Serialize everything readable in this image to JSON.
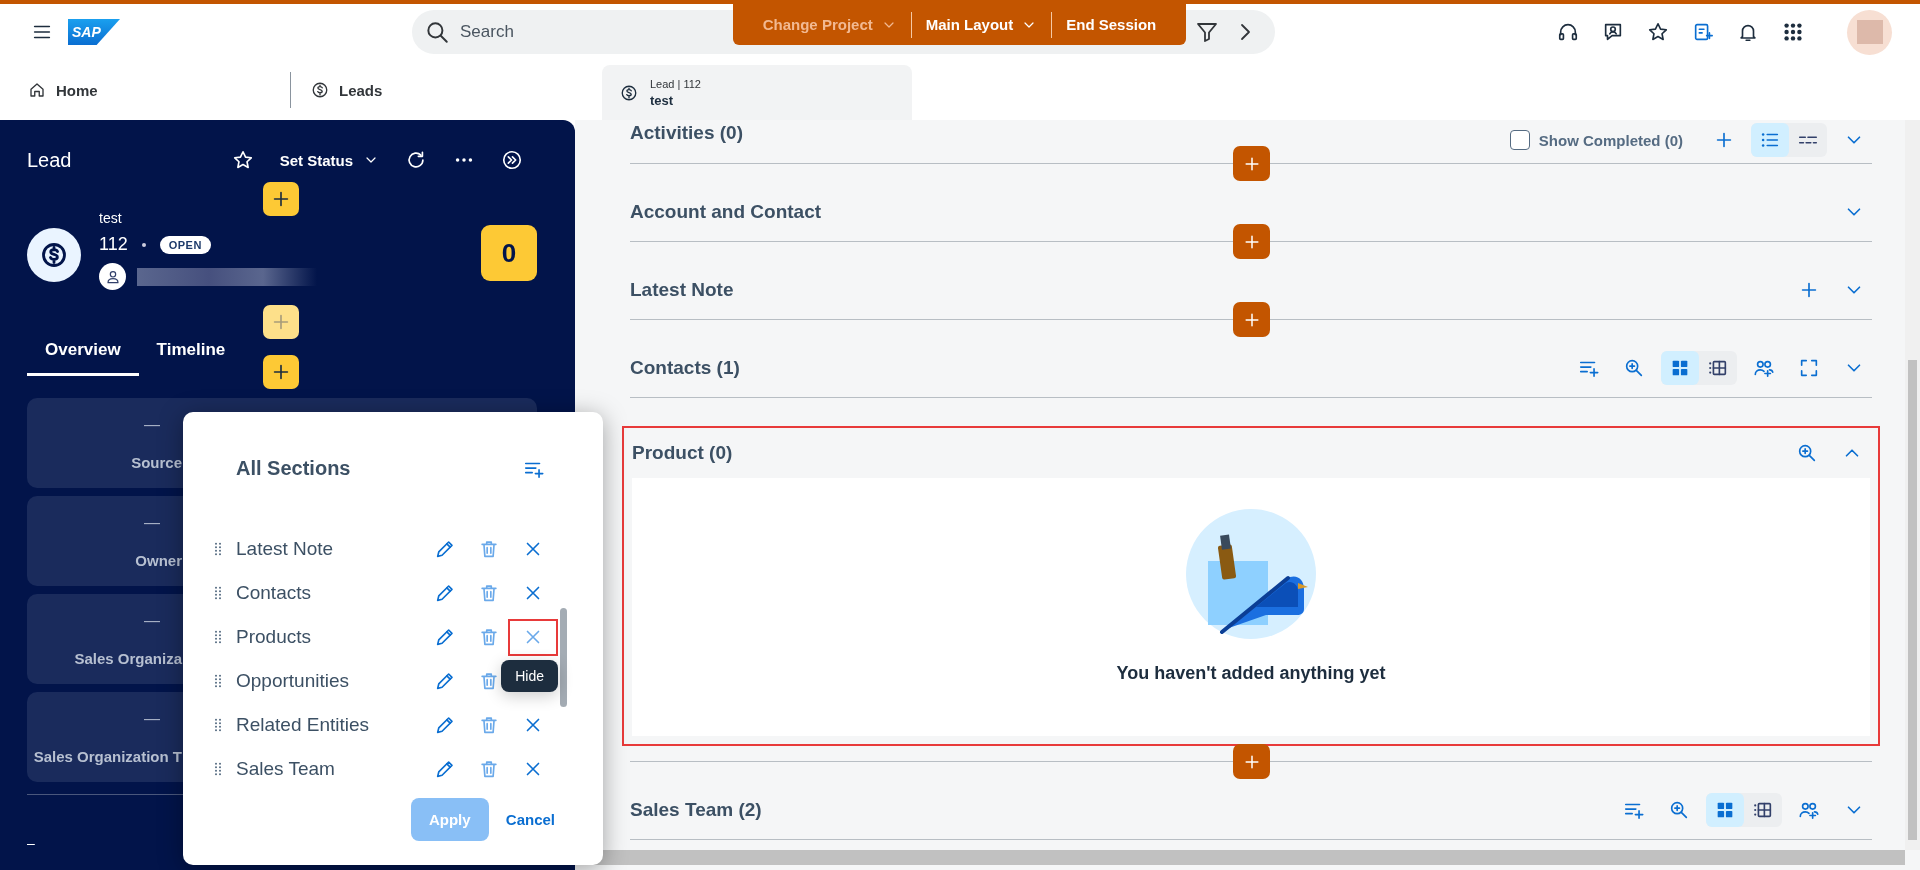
{
  "header": {
    "logo": "SAP",
    "search": {
      "placeholder": "Search"
    },
    "session_bar": [
      {
        "label": "Change Project",
        "dropdown": true,
        "disabled": true
      },
      {
        "label": "Main Layout",
        "dropdown": true,
        "disabled": false
      },
      {
        "label": "End Session",
        "dropdown": false,
        "disabled": false
      }
    ]
  },
  "nav": {
    "items": [
      {
        "label": "Home",
        "kind": "home"
      },
      {
        "label": "Leads",
        "kind": "lead"
      }
    ],
    "open_tab": {
      "caption": "Lead | 112",
      "title": "test"
    }
  },
  "lead_panel": {
    "title": "Lead",
    "status_button": "Set Status",
    "name": "test",
    "number": "112",
    "status": "OPEN",
    "score": "0",
    "insert_buttons": [
      {
        "disabled": false
      },
      {
        "disabled": true
      },
      {
        "disabled": false
      }
    ],
    "tabs": [
      {
        "label": "Overview",
        "selected": true
      },
      {
        "label": "Timeline",
        "selected": false
      }
    ],
    "fields": [
      {
        "value": "—",
        "label": "Source"
      },
      {
        "value": "—",
        "label": "Owner"
      },
      {
        "value": "—",
        "label": "Sales Organiza"
      },
      {
        "value": "—",
        "label": "Sales Organization T"
      }
    ],
    "footer_value": "–"
  },
  "sections_dialog": {
    "title": "All Sections",
    "tooltip": "Hide",
    "rows": [
      {
        "label": "Latest Note",
        "highlighted": false
      },
      {
        "label": "Contacts",
        "highlighted": false
      },
      {
        "label": "Products",
        "highlighted": true
      },
      {
        "label": "Opportunities",
        "highlighted": false
      },
      {
        "label": "Related Entities",
        "highlighted": false
      },
      {
        "label": "Sales Team",
        "highlighted": false
      }
    ],
    "buttons": [
      {
        "label": "Apply",
        "kind": "primary",
        "disabled": true
      },
      {
        "label": "Cancel",
        "kind": "link",
        "disabled": false
      }
    ]
  },
  "sections": [
    {
      "title": "Activities (0)",
      "expanded": false,
      "highlighted": false,
      "insert_button": true,
      "show_completed": {
        "label": "Show Completed (0)",
        "checked": false
      },
      "actions": [
        {
          "kind": "add"
        },
        {
          "kind": "list-view",
          "selected": true
        },
        {
          "kind": "rows-view",
          "selected": false
        }
      ]
    },
    {
      "title": "Account and Contact",
      "expanded": false,
      "highlighted": false,
      "insert_button": true
    },
    {
      "title": "Latest Note",
      "expanded": false,
      "highlighted": false,
      "insert_button": true,
      "actions": [
        {
          "kind": "add"
        }
      ]
    },
    {
      "title": "Contacts (1)",
      "expanded": false,
      "highlighted": false,
      "insert_button": false,
      "actions": [
        {
          "kind": "sort-add"
        },
        {
          "kind": "search-add"
        },
        {
          "kind": "grid-view",
          "selected": true
        },
        {
          "kind": "table-view",
          "selected": false
        },
        {
          "kind": "people-add"
        },
        {
          "kind": "fullscreen"
        }
      ]
    },
    {
      "title": "Product (0)",
      "expanded": true,
      "highlighted": true,
      "insert_button": true,
      "actions": [
        {
          "kind": "search-add"
        }
      ],
      "empty_message": "You haven't added anything yet"
    },
    {
      "title": "Sales Team (2)",
      "expanded": false,
      "highlighted": false,
      "insert_button": false,
      "actions": [
        {
          "kind": "sort-add"
        },
        {
          "kind": "search-add"
        },
        {
          "kind": "grid-view",
          "selected": true
        },
        {
          "kind": "table-view",
          "selected": false
        },
        {
          "kind": "people-add"
        }
      ]
    }
  ]
}
